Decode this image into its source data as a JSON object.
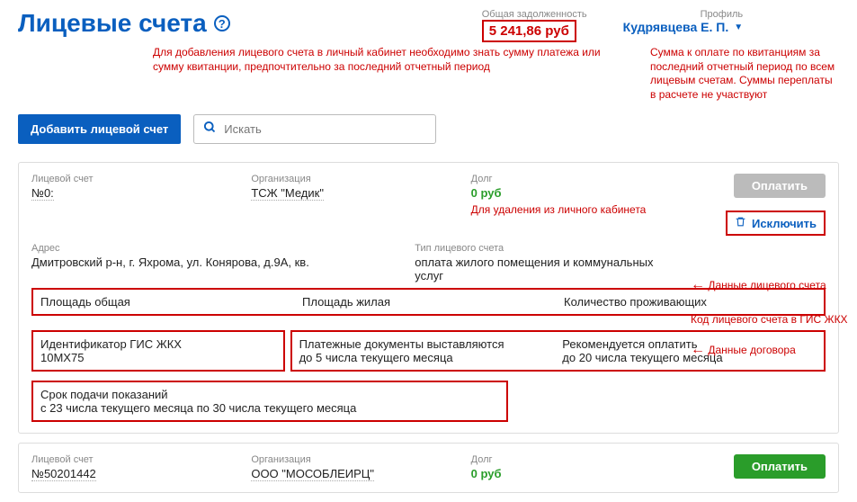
{
  "header": {
    "title": "Лицевые счета",
    "debt_label": "Общая задолженность",
    "debt_value": "5 241,86 руб",
    "profile_label": "Профиль",
    "profile_name": "Кудрявцева Е. П."
  },
  "notes": {
    "add_hint": "Для добавления лицевого счета в личный кабинет необходимо знать сумму платежа или сумму квитанции, предпочтительно за последний отчетный период",
    "debt_hint": "Сумма к оплате по квитанциям за последний отчетный период по всем лицевым счетам. Суммы переплаты в расчете не участвуют",
    "delete_hint": "Для удаления из личного кабинета",
    "acct_data": "Данные лицевого счета",
    "gis_code": "Код лицевого счета в ГИС ЖКХ",
    "contract_data": "Данные договора"
  },
  "toolbar": {
    "add_label": "Добавить лицевой счет",
    "search_placeholder": "Искать"
  },
  "labels": {
    "account": "Лицевой счет",
    "org": "Организация",
    "debt": "Долг",
    "address": "Адрес",
    "acct_type": "Тип лицевого счета",
    "area_total": "Площадь общая",
    "area_living": "Площадь жилая",
    "residents": "Количество проживающих",
    "gis_id": "Идентификатор ГИС ЖКХ",
    "docs_issued": "Платежные документы выставляются",
    "pay_rec": "Рекомендуется оплатить",
    "readings": "Срок подачи показаний",
    "pay": "Оплатить",
    "exclude": "Исключить"
  },
  "card1": {
    "account": "№0:",
    "org": "ТСЖ \"Медик\"",
    "debt": "0 руб",
    "address": "Дмитровский р-н, г. Яхрома, ул. Конярова, д.9А, кв.",
    "acct_type": "оплата жилого помещения и коммунальных услуг",
    "gis_id": "10МХ75",
    "docs_issued": "до 5 числа текущего месяца",
    "pay_rec": "до 20 числа текущего месяца",
    "readings": "с 23 числа текущего месяца по 30 числа текущего месяца"
  },
  "card2": {
    "account": "№50201442",
    "org": "ООО \"МОСОБЛЕИРЦ\"",
    "debt": "0 руб"
  }
}
